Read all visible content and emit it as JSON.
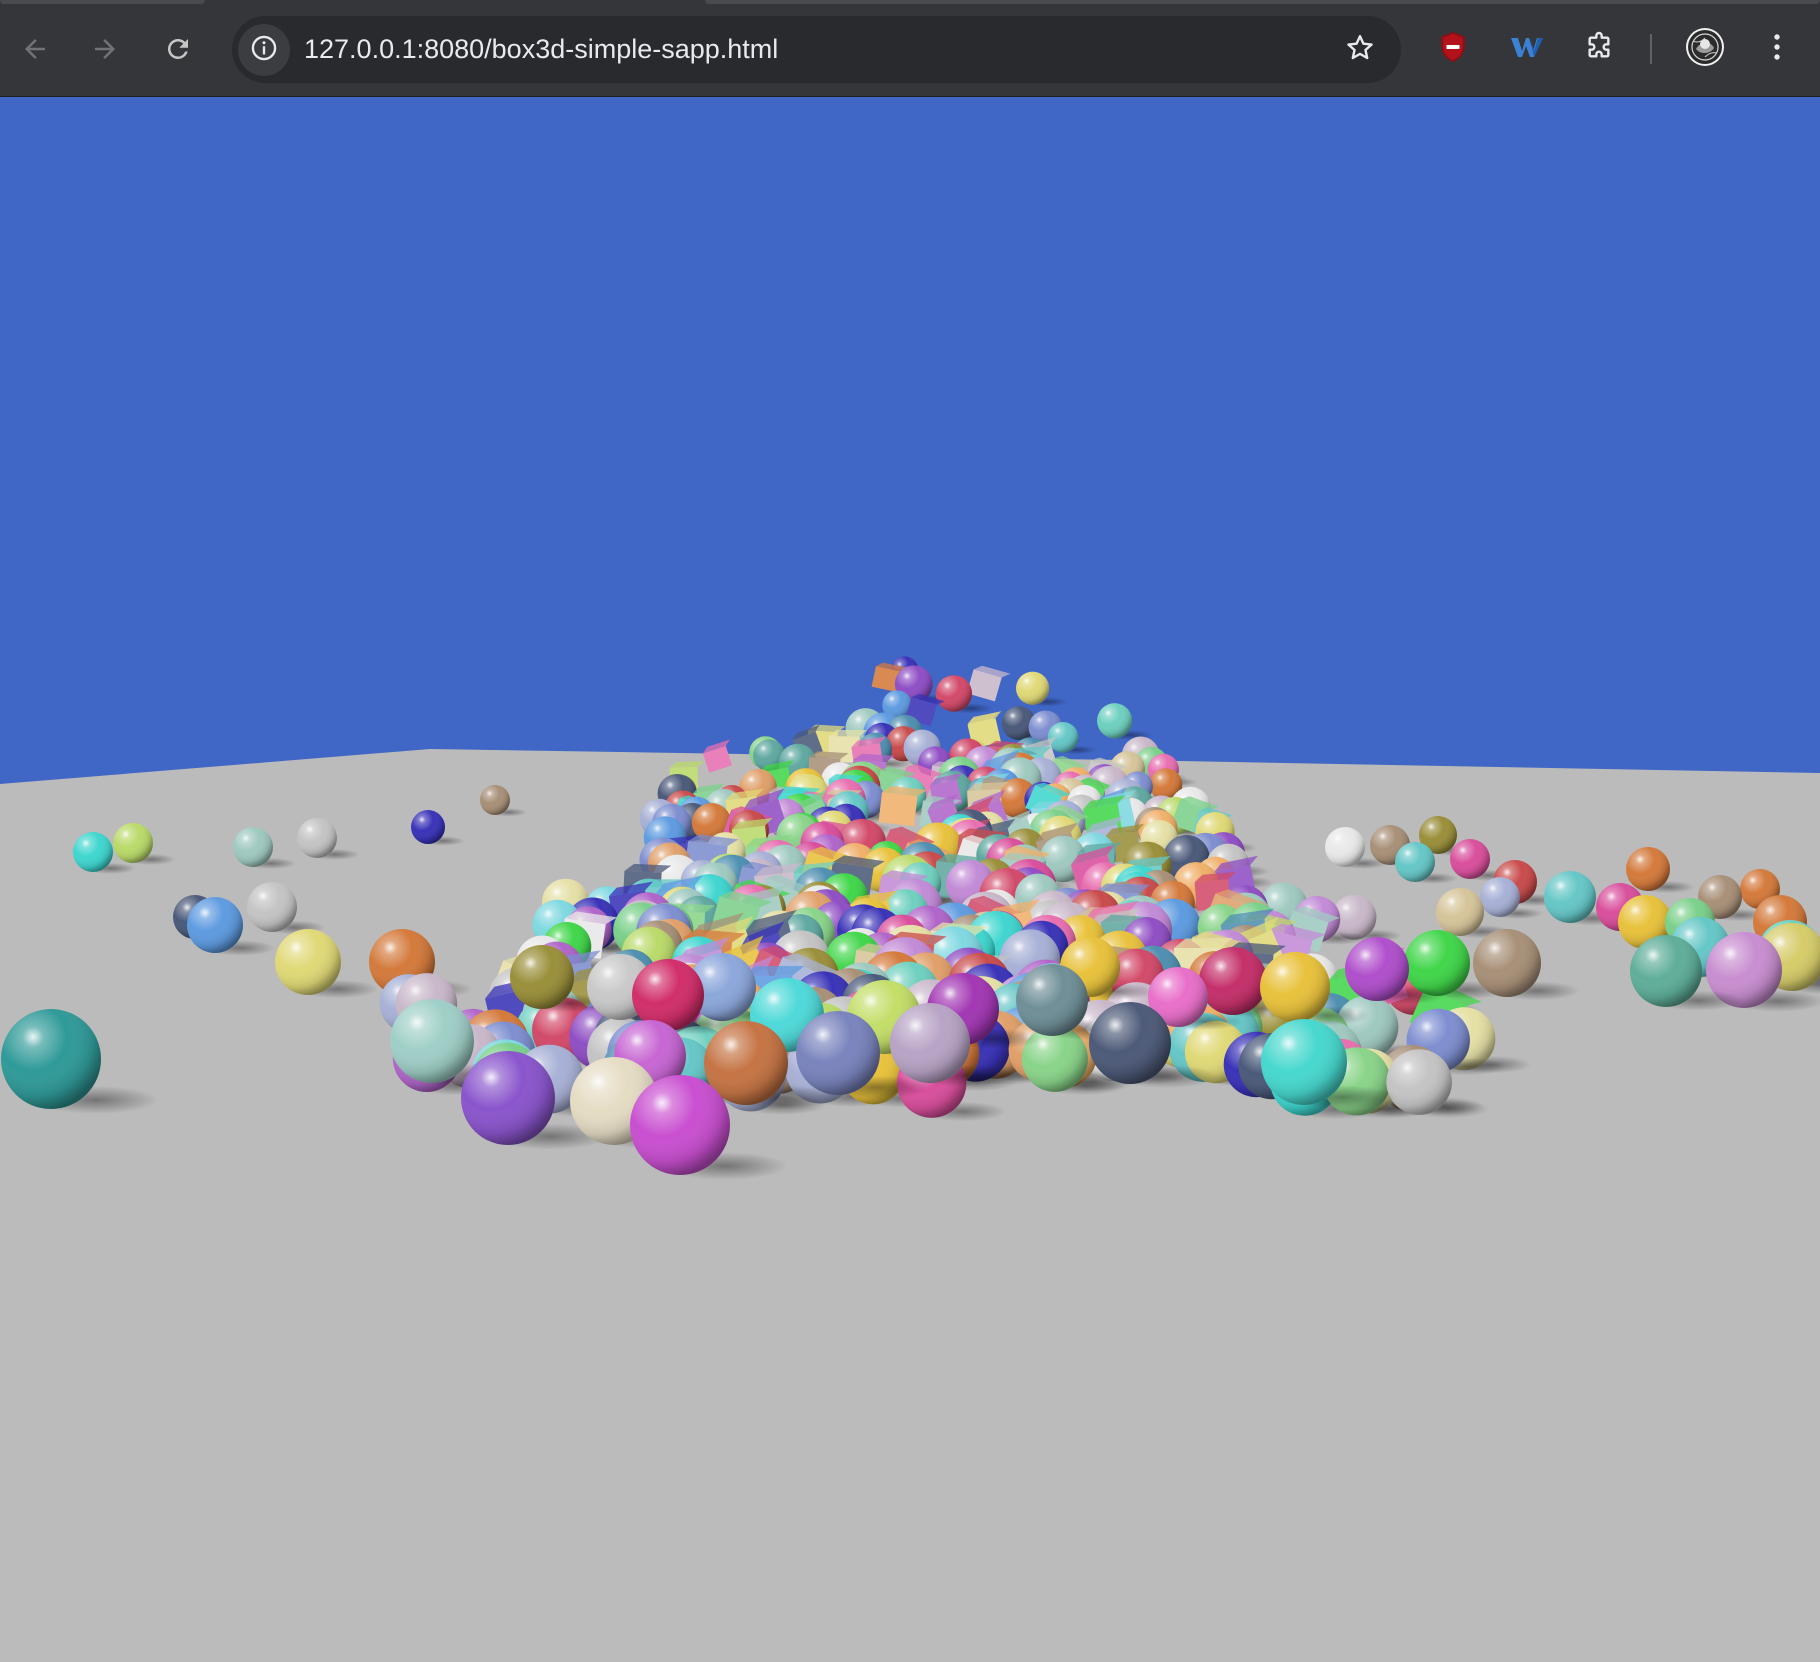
{
  "browser": {
    "url": "127.0.0.1:8080/box3d-simple-sapp.html",
    "icons": {
      "back": "arrow-left-icon",
      "forward": "arrow-right-icon",
      "reload": "reload-icon",
      "site_info": "info-icon",
      "bookmark": "star-icon",
      "ext_shield": "shield-icon",
      "ext_w": "w-logo-icon",
      "extensions": "puzzle-icon",
      "profile": "avatar-icon",
      "menu": "kebab-menu-icon"
    },
    "colors": {
      "toolbar": "#35363a",
      "omnibox": "#292a2d",
      "text": "#e8eaed",
      "icon": "#9aa0a6",
      "shield": "#b3121b",
      "w_logo": "#3b82d6"
    }
  },
  "scene": {
    "colors": {
      "sky": "#4066c6",
      "ground": "#bbbbbb"
    }
  }
}
